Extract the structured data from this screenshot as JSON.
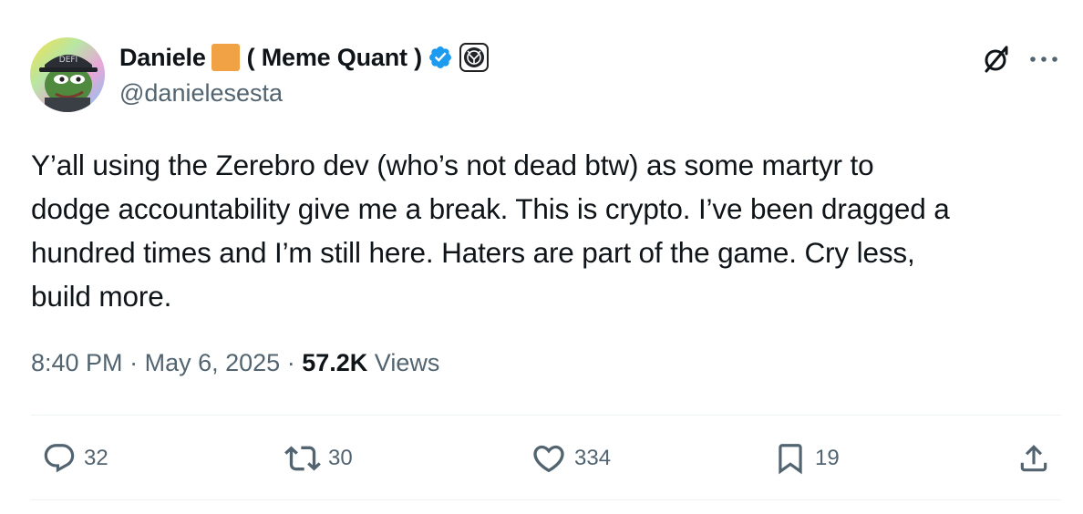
{
  "author": {
    "display_name": "Daniele",
    "name_suffix": "( Meme Quant )",
    "handle": "@danielesesta",
    "avatar_icon": "pepe-frog-avatar",
    "avatar_cap_text": "DEFI",
    "verified_icon": "verified-badge-icon",
    "affiliate_icon": "affiliate-badge-icon",
    "box_color": "#f0a245",
    "verified_color": "#1d9bf0"
  },
  "tweet": {
    "text": "Y’all using the Zerebro dev (who’s not dead btw) as some martyr to\ndodge accountability give me a break. This is crypto. I’ve been dragged a\nhundred times and I’m still here. Haters are part of the game. Cry less,\nbuild more.",
    "time": "8:40 PM",
    "separator": "·",
    "date": "May 6, 2025",
    "views_count": "57.2K",
    "views_label": "Views"
  },
  "actions": {
    "replies": "32",
    "reposts": "30",
    "likes": "334",
    "bookmarks": "19"
  }
}
